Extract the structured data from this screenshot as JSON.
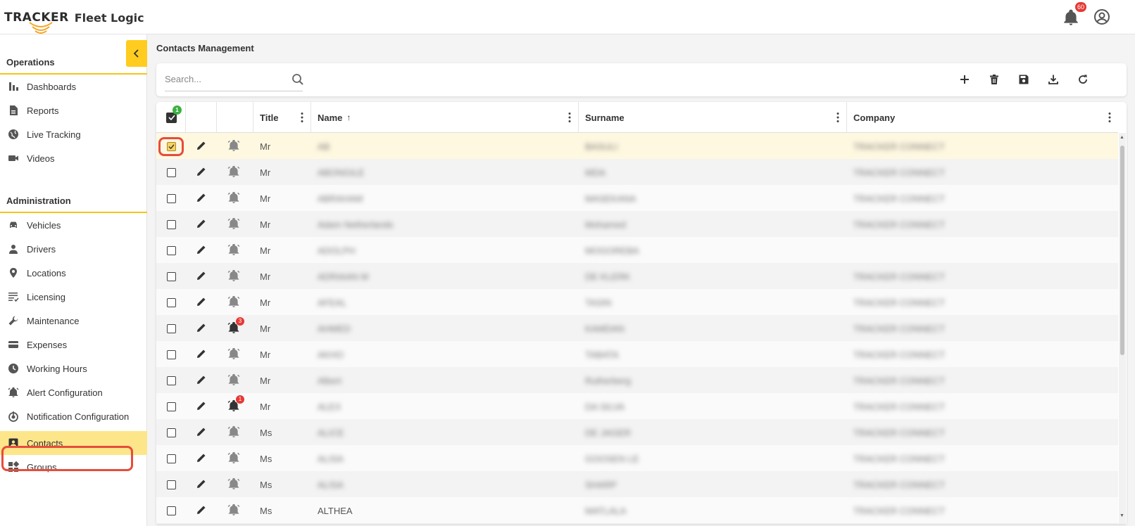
{
  "app": {
    "brand_primary": "TRACKER",
    "brand_secondary": "Fleet Logic",
    "notification_count": "60"
  },
  "colors": {
    "accent": "#ffcc1f",
    "highlight": "#fde68a",
    "badge_red": "#e53935",
    "badge_green": "#3cb043",
    "annotation_ring": "#e74c3c"
  },
  "sidebar": {
    "sections": [
      {
        "title": "Operations",
        "items": [
          {
            "label": "Dashboards",
            "icon": "bar-chart-icon"
          },
          {
            "label": "Reports",
            "icon": "document-icon"
          },
          {
            "label": "Live Tracking",
            "icon": "globe-icon"
          },
          {
            "label": "Videos",
            "icon": "video-camera-icon"
          }
        ]
      },
      {
        "title": "Administration",
        "items": [
          {
            "label": "Vehicles",
            "icon": "car-icon"
          },
          {
            "label": "Drivers",
            "icon": "person-icon"
          },
          {
            "label": "Locations",
            "icon": "map-pin-icon"
          },
          {
            "label": "Licensing",
            "icon": "list-check-icon"
          },
          {
            "label": "Maintenance",
            "icon": "wrench-icon"
          },
          {
            "label": "Expenses",
            "icon": "credit-card-icon"
          },
          {
            "label": "Working Hours",
            "icon": "clock-icon"
          },
          {
            "label": "Alert Configuration",
            "icon": "alarm-bell-icon"
          },
          {
            "label": "Notification Configuration",
            "icon": "notification-settings-icon"
          },
          {
            "label": "Contacts",
            "icon": "contact-card-icon",
            "active": true
          },
          {
            "label": "Groups",
            "icon": "groups-icon"
          }
        ]
      }
    ]
  },
  "page": {
    "title": "Contacts Management"
  },
  "search": {
    "placeholder": "Search..."
  },
  "toolbar": {
    "actions": [
      "add-icon",
      "delete-icon",
      "save-icon",
      "download-icon",
      "refresh-icon"
    ]
  },
  "grid": {
    "selected_count": "1",
    "columns": {
      "title": "Title",
      "name": "Name",
      "name_sort": "↑",
      "surname": "Surname",
      "company": "Company"
    },
    "rows": [
      {
        "title": "Mr",
        "name": "AB",
        "surname": "BASULI",
        "company": "TRACKER CONNECT",
        "checked": true,
        "alerts": ""
      },
      {
        "title": "Mr",
        "name": "ABONGILE",
        "surname": "MDA",
        "company": "TRACKER CONNECT",
        "checked": false,
        "alerts": ""
      },
      {
        "title": "Mr",
        "name": "ABRAHAM",
        "surname": "MASEKANA",
        "company": "TRACKER CONNECT",
        "checked": false,
        "alerts": ""
      },
      {
        "title": "Mr",
        "name": "Adam Netherlands",
        "surname": "Mohamed",
        "company": "TRACKER CONNECT",
        "checked": false,
        "alerts": ""
      },
      {
        "title": "Mr",
        "name": "ADOLPH",
        "surname": "MOGOREBA",
        "company": "",
        "checked": false,
        "alerts": ""
      },
      {
        "title": "Mr",
        "name": "ADRIAAN M",
        "surname": "DE KLERK",
        "company": "TRACKER CONNECT",
        "checked": false,
        "alerts": ""
      },
      {
        "title": "Mr",
        "name": "AFEAL",
        "surname": "TASIN",
        "company": "TRACKER CONNECT",
        "checked": false,
        "alerts": ""
      },
      {
        "title": "Mr",
        "name": "AHMED",
        "surname": "KAMDAN",
        "company": "TRACKER CONNECT",
        "checked": false,
        "alerts": "3"
      },
      {
        "title": "Mr",
        "name": "AKHO",
        "surname": "TABATA",
        "company": "TRACKER CONNECT",
        "checked": false,
        "alerts": ""
      },
      {
        "title": "Mr",
        "name": "Albert",
        "surname": "Rutherberg",
        "company": "TRACKER CONNECT",
        "checked": false,
        "alerts": ""
      },
      {
        "title": "Mr",
        "name": "ALEX",
        "surname": "DA SILVA",
        "company": "TRACKER CONNECT",
        "checked": false,
        "alerts": "1"
      },
      {
        "title": "Ms",
        "name": "ALICE",
        "surname": "DE JAGER",
        "company": "TRACKER CONNECT",
        "checked": false,
        "alerts": ""
      },
      {
        "title": "Ms",
        "name": "ALISA",
        "surname": "GOOSEN LE",
        "company": "TRACKER CONNECT",
        "checked": false,
        "alerts": ""
      },
      {
        "title": "Ms",
        "name": "ALISA",
        "surname": "SHARP",
        "company": "TRACKER CONNECT",
        "checked": false,
        "alerts": ""
      },
      {
        "title": "Ms",
        "name": "ALTHEA",
        "surname": "MATLALA",
        "company": "TRACKER CONNECT",
        "checked": false,
        "alerts": ""
      }
    ]
  }
}
